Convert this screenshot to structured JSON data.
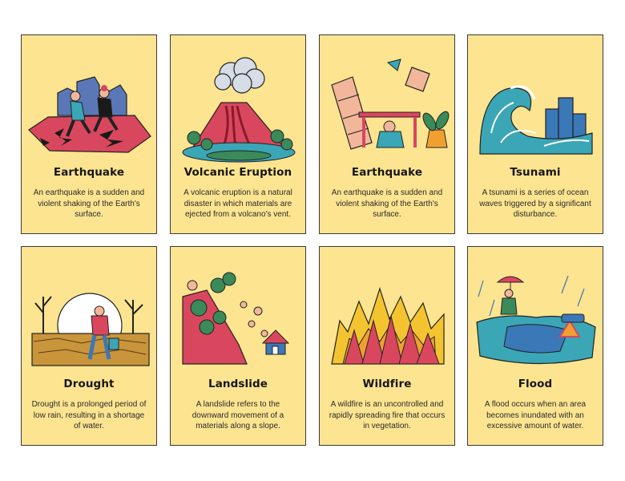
{
  "cards": [
    {
      "title": "Earthquake",
      "text": "An earthquake is a sudden and violent shaking of the Earth's surface.",
      "icon": "earthquake-icon"
    },
    {
      "title": "Volcanic Eruption",
      "text": "A volcanic eruption is a natural disaster in which materials are ejected from a volcano's vent.",
      "icon": "volcano-icon"
    },
    {
      "title": "Earthquake",
      "text": "An earthquake is a sudden and violent shaking of the Earth's surface.",
      "icon": "earthquake-shelter-icon"
    },
    {
      "title": "Tsunami",
      "text": "A tsunami is a series of ocean waves triggered by a significant disturbance.",
      "icon": "tsunami-icon"
    },
    {
      "title": "Drought",
      "text": "Drought is a prolonged period of low rain, resulting in a shortage of water.",
      "icon": "drought-icon"
    },
    {
      "title": "Landslide",
      "text": "A landslide refers to the downward movement of a materials along a slope.",
      "icon": "landslide-icon"
    },
    {
      "title": "Wildfire",
      "text": "A wildfire is an uncontrolled and rapidly spreading fire that occurs in vegetation.",
      "icon": "wildfire-icon"
    },
    {
      "title": "Flood",
      "text": "A flood occurs when an area becomes inundated with an excessive amount of water.",
      "icon": "flood-icon"
    }
  ],
  "colors": {
    "card_bg": "#fde490",
    "red": "#d9475f",
    "teal": "#3aa6b6",
    "green": "#3a8a5a",
    "orange": "#f0a030"
  }
}
